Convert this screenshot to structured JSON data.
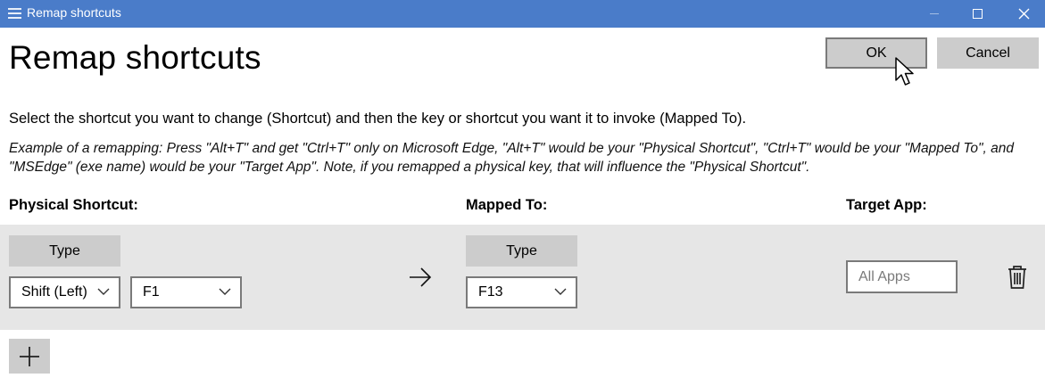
{
  "window": {
    "title": "Remap shortcuts"
  },
  "header": {
    "title": "Remap shortcuts",
    "ok_label": "OK",
    "cancel_label": "Cancel"
  },
  "instructions": "Select the shortcut you want to change (Shortcut) and then the key or shortcut you want it to invoke (Mapped To).",
  "example_line1": "Example of a remapping: Press \"Alt+T\" and get \"Ctrl+T\" only on Microsoft Edge, \"Alt+T\" would be your \"Physical Shortcut\", \"Ctrl+T\" would be your \"Mapped To\", and",
  "example_line2": "\"MSEdge\" (exe name) would be your \"Target App\". Note, if you remapped a physical key, that will influence the \"Physical Shortcut\".",
  "columns": {
    "physical": "Physical Shortcut:",
    "mapped": "Mapped To:",
    "target": "Target App:"
  },
  "rows": [
    {
      "physical_type_label": "Type",
      "physical_keys": [
        "Shift (Left)",
        "F1"
      ],
      "mapped_type_label": "Type",
      "mapped_keys": [
        "F13"
      ],
      "target_app_value": "",
      "target_app_placeholder": "All Apps"
    }
  ],
  "icons": {
    "app": "keyboard-icon",
    "minimize": "minimize-icon",
    "maximize": "maximize-icon",
    "close": "close-icon",
    "arrow": "arrow-right-icon",
    "delete": "trash-icon",
    "add": "plus-icon",
    "chevron": "chevron-down-icon",
    "cursor": "mouse-pointer-icon"
  },
  "colors": {
    "titlebar": "#4a7cc9",
    "button": "#cccccc",
    "row_background": "#e6e6e6",
    "border": "#7a7a7a"
  }
}
